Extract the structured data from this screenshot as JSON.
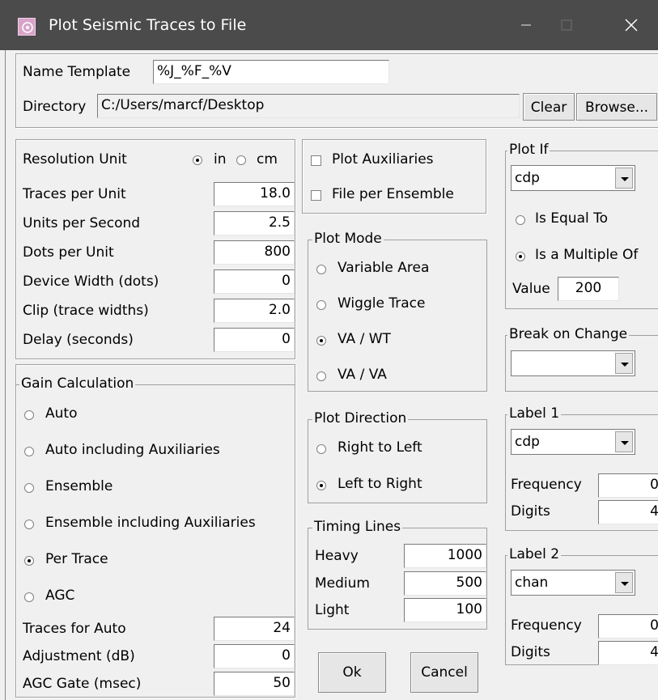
{
  "window": {
    "title": "Plot Seismic Traces to File"
  },
  "file": {
    "name_template_label": "Name Template",
    "name_template_value": "%J_%F_%V",
    "directory_label": "Directory",
    "directory_value": "C:/Users/marcf/Desktop",
    "clear_label": "Clear",
    "browse_label": "Browse..."
  },
  "resolution": {
    "unit_label": "Resolution Unit",
    "unit_options": [
      "in",
      "cm"
    ],
    "unit_selected": "in",
    "rows": [
      {
        "label": "Traces per Unit",
        "value": "18.0"
      },
      {
        "label": "Units per Second",
        "value": "2.5"
      },
      {
        "label": "Dots per Unit",
        "value": "800"
      },
      {
        "label": "Device Width (dots)",
        "value": "0"
      },
      {
        "label": "Clip (trace widths)",
        "value": "2.0"
      },
      {
        "label": "Delay (seconds)",
        "value": "0"
      }
    ]
  },
  "gain": {
    "title": "Gain Calculation",
    "options": [
      "Auto",
      "Auto including Auxiliaries",
      "Ensemble",
      "Ensemble including Auxiliaries",
      "Per Trace",
      "AGC"
    ],
    "selected": "Per Trace",
    "rows": [
      {
        "label": "Traces for Auto",
        "value": "24"
      },
      {
        "label": "Adjustment (dB)",
        "value": "0"
      },
      {
        "label": "AGC Gate (msec)",
        "value": "50"
      }
    ]
  },
  "options": {
    "plot_auxiliaries": "Plot Auxiliaries",
    "file_per_ensemble": "File per Ensemble"
  },
  "plot_mode": {
    "title": "Plot Mode",
    "options": [
      "Variable Area",
      "Wiggle Trace",
      "VA / WT",
      "VA / VA"
    ],
    "selected": "VA / WT"
  },
  "plot_direction": {
    "title": "Plot Direction",
    "options": [
      "Right to Left",
      "Left to Right"
    ],
    "selected": "Left to Right"
  },
  "timing_lines": {
    "title": "Timing Lines",
    "rows": [
      {
        "label": "Heavy",
        "value": "1000"
      },
      {
        "label": "Medium",
        "value": "500"
      },
      {
        "label": "Light",
        "value": "100"
      }
    ]
  },
  "buttons": {
    "ok": "Ok",
    "cancel": "Cancel"
  },
  "plot_if": {
    "title": "Plot If",
    "header": "cdp",
    "options": [
      "Is Equal To",
      "Is a Multiple Of"
    ],
    "selected": "Is a Multiple Of",
    "value_label": "Value",
    "value": "200"
  },
  "break_on_change": {
    "title": "Break on Change",
    "header": ""
  },
  "label1": {
    "title": "Label 1",
    "header": "cdp",
    "frequency_label": "Frequency",
    "frequency": "0",
    "digits_label": "Digits",
    "digits": "4"
  },
  "label2": {
    "title": "Label 2",
    "header": "chan",
    "frequency_label": "Frequency",
    "frequency": "0",
    "digits_label": "Digits",
    "digits": "4"
  },
  "colors": {
    "titlebar": "#4b4b4b",
    "window_bg": "#f0f0f0",
    "field_bg": "#ffffff"
  }
}
